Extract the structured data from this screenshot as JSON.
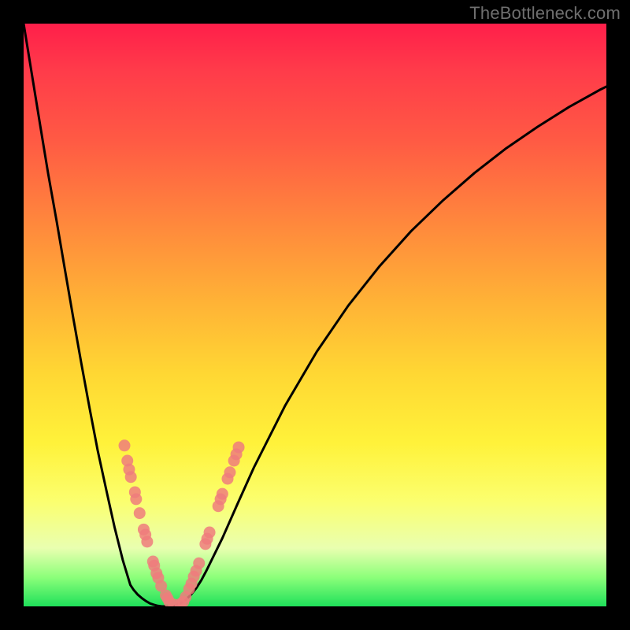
{
  "watermark": "TheBottleneck.com",
  "colors": {
    "background": "#000000",
    "gradient_top": "#ff1f4a",
    "gradient_mid": "#fff23a",
    "gradient_bottom": "#1fe05a",
    "curve": "#000000",
    "markers": "#ef7d7d"
  },
  "chart_data": {
    "type": "line",
    "title": "",
    "xlabel": "",
    "ylabel": "",
    "xlim": [
      0,
      100
    ],
    "ylim": [
      0,
      100
    ],
    "note": "No axis ticks or numeric labels are visible; values are in relative 0–100 plot coordinates estimated from pixel positions.",
    "series": [
      {
        "name": "left-curve",
        "x": [
          0.0,
          1.4,
          2.8,
          4.2,
          5.7,
          7.1,
          8.5,
          9.9,
          11.3,
          12.7,
          14.2,
          15.6,
          17.0,
          18.3,
          18.9,
          19.6,
          20.3,
          21.0,
          21.7,
          22.3,
          23.0,
          23.7,
          24.4,
          25.1
        ],
        "y": [
          100.0,
          91.4,
          82.8,
          74.3,
          65.9,
          57.7,
          49.6,
          41.7,
          34.1,
          26.8,
          19.9,
          13.6,
          8.0,
          3.7,
          2.8,
          2.0,
          1.4,
          0.9,
          0.5,
          0.3,
          0.1,
          0.0,
          0.0,
          0.0
        ]
      },
      {
        "name": "right-curve",
        "x": [
          25.1,
          26.0,
          26.9,
          27.8,
          28.7,
          29.6,
          30.5,
          31.4,
          34.1,
          36.8,
          39.5,
          44.9,
          50.3,
          55.7,
          61.1,
          66.5,
          72.0,
          77.4,
          82.8,
          88.2,
          93.6,
          99.0,
          100.0
        ],
        "y": [
          0.0,
          0.1,
          0.5,
          1.1,
          2.0,
          3.1,
          4.5,
          6.2,
          11.7,
          17.8,
          23.8,
          34.5,
          43.7,
          51.6,
          58.4,
          64.4,
          69.7,
          74.4,
          78.6,
          82.3,
          85.7,
          88.7,
          89.2
        ]
      }
    ],
    "markers": {
      "name": "highlight-points",
      "points": [
        {
          "x": 17.3,
          "y": 27.6
        },
        {
          "x": 17.8,
          "y": 25.0
        },
        {
          "x": 18.1,
          "y": 23.5
        },
        {
          "x": 18.4,
          "y": 22.2
        },
        {
          "x": 19.1,
          "y": 19.6
        },
        {
          "x": 19.3,
          "y": 18.4
        },
        {
          "x": 19.9,
          "y": 16.0
        },
        {
          "x": 20.6,
          "y": 13.2
        },
        {
          "x": 20.9,
          "y": 12.3
        },
        {
          "x": 21.2,
          "y": 11.1
        },
        {
          "x": 22.2,
          "y": 7.7
        },
        {
          "x": 22.4,
          "y": 7.0
        },
        {
          "x": 22.8,
          "y": 5.7
        },
        {
          "x": 23.1,
          "y": 4.9
        },
        {
          "x": 23.6,
          "y": 3.5
        },
        {
          "x": 24.4,
          "y": 1.9
        },
        {
          "x": 24.7,
          "y": 1.4
        },
        {
          "x": 25.0,
          "y": 0.8
        },
        {
          "x": 25.8,
          "y": 0.3
        },
        {
          "x": 26.9,
          "y": 0.4
        },
        {
          "x": 27.4,
          "y": 0.8
        },
        {
          "x": 27.8,
          "y": 1.6
        },
        {
          "x": 28.4,
          "y": 3.0
        },
        {
          "x": 28.8,
          "y": 3.9
        },
        {
          "x": 29.2,
          "y": 5.1
        },
        {
          "x": 29.6,
          "y": 6.1
        },
        {
          "x": 30.1,
          "y": 7.4
        },
        {
          "x": 31.2,
          "y": 10.7
        },
        {
          "x": 31.5,
          "y": 11.6
        },
        {
          "x": 31.9,
          "y": 12.7
        },
        {
          "x": 33.4,
          "y": 17.2
        },
        {
          "x": 33.8,
          "y": 18.4
        },
        {
          "x": 34.1,
          "y": 19.3
        },
        {
          "x": 35.0,
          "y": 21.9
        },
        {
          "x": 35.4,
          "y": 23.0
        },
        {
          "x": 36.1,
          "y": 25.0
        },
        {
          "x": 36.5,
          "y": 26.1
        },
        {
          "x": 36.9,
          "y": 27.3
        }
      ]
    }
  }
}
